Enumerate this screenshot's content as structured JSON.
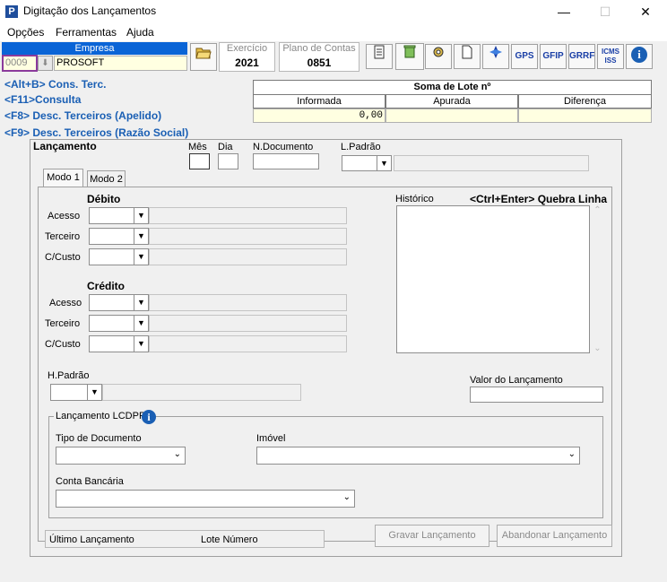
{
  "window": {
    "title": "Digitação dos Lançamentos",
    "icon_letter": "P",
    "minimize": "—",
    "maximize": "☐",
    "close": "✕"
  },
  "menu": {
    "items": [
      "Opções",
      "Ferramentas",
      "Ajuda"
    ]
  },
  "empresa": {
    "header": "Empresa",
    "code": "0009",
    "name": "PROSOFT"
  },
  "exercicio": {
    "label": "Exercício",
    "value": "2021"
  },
  "plano": {
    "label": "Plano de Contas",
    "value": "0851"
  },
  "toolbar": {
    "gps": "GPS",
    "gfip": "GFIP",
    "grrf": "GRRF",
    "icms": "ICMS ISS",
    "info": "i"
  },
  "shortcuts": [
    "<Alt+B> Cons. Terc.",
    "<F11>Consulta",
    "<F8> Desc. Terceiros (Apelido)",
    "<F9> Desc. Terceiros (Razão Social)"
  ],
  "lote": {
    "title": "Soma de Lote nº",
    "informada": "Informada",
    "apurada": "Apurada",
    "diferenca": "Diferença",
    "informada_value": "0,00"
  },
  "lancamento": {
    "title": "Lançamento",
    "mes": "Mês",
    "dia": "Dia",
    "ndoc": "N.Documento",
    "lpadrao": "L.Padrão"
  },
  "tabs": [
    "Modo 1",
    "Modo 2"
  ],
  "debito": {
    "title": "Débito",
    "acesso": "Acesso",
    "terceiro": "Terceiro",
    "ccusto": "C/Custo"
  },
  "credito": {
    "title": "Crédito",
    "acesso": "Acesso",
    "terceiro": "Terceiro",
    "ccusto": "C/Custo"
  },
  "historico": {
    "label": "Histórico",
    "hint": "<Ctrl+Enter> Quebra Linha"
  },
  "hpadrao": {
    "label": "H.Padrão"
  },
  "valor": {
    "label": "Valor do Lançamento"
  },
  "lcdpr": {
    "title": "Lançamento LCDPR",
    "tipo": "Tipo de Documento",
    "imovel": "Imóvel",
    "conta": "Conta Bancária"
  },
  "footer": {
    "ultimo": "Último Lançamento",
    "lote_numero": "Lote Número",
    "gravar": "Gravar Lançamento",
    "abandonar": "Abandonar Lançamento"
  }
}
